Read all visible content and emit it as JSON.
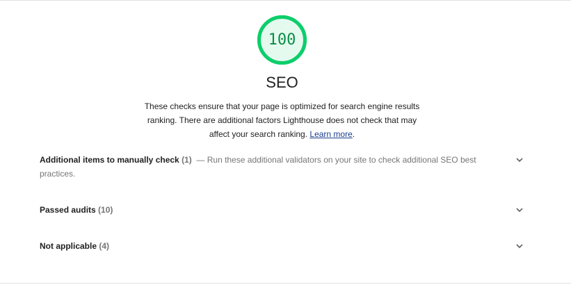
{
  "gauge": {
    "score": "100",
    "fraction": 1.0,
    "color": "#0cce6b",
    "fill_color": "#e5faef",
    "text_color": "#0b8d47"
  },
  "category": {
    "title": "SEO",
    "description_text": "These checks ensure that your page is optimized for search engine results ranking. There are additional factors Lighthouse does not check that may affect your search ranking.",
    "learn_more_label": "Learn more",
    "trailing_period": "."
  },
  "groups": [
    {
      "title": "Additional items to manually check",
      "count": "(1)",
      "separator": "—",
      "description": "Run these additional validators on your site to check additional SEO best practices.",
      "icon": "chevron-down-icon"
    },
    {
      "title": "Passed audits",
      "count": "(10)",
      "icon": "chevron-down-icon"
    },
    {
      "title": "Not applicable",
      "count": "(4)",
      "icon": "chevron-down-icon"
    }
  ]
}
